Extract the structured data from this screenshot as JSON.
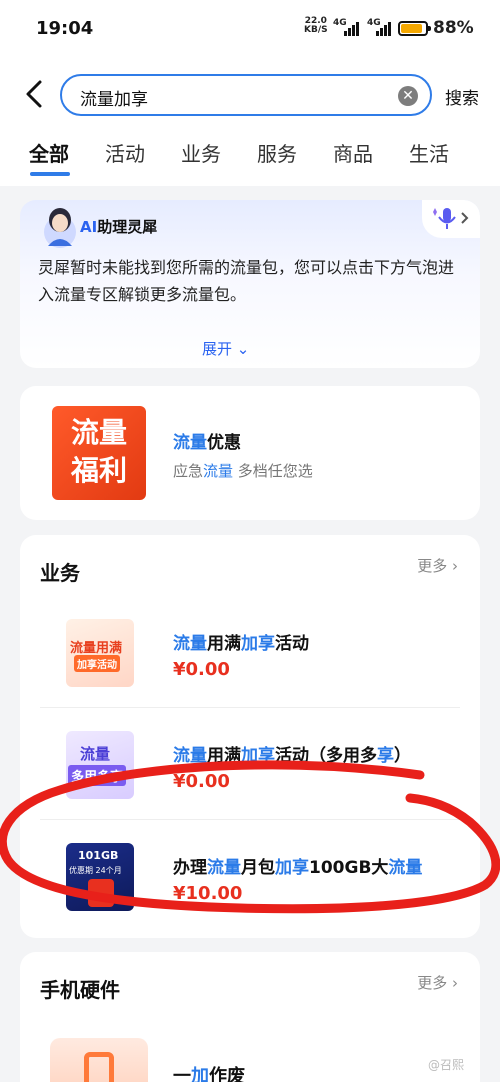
{
  "status": {
    "time": "19:04",
    "speed_value": "22.0",
    "speed_unit": "KB/S",
    "sim1": "4G",
    "sim2": "4G",
    "battery": "88%",
    "battery_level": 0.88
  },
  "search": {
    "query": "流量加享",
    "search_label": "搜索"
  },
  "tabs": [
    "全部",
    "活动",
    "业务",
    "服务",
    "商品",
    "生活"
  ],
  "assistant": {
    "badge": "AI",
    "name": "助理灵犀",
    "message": "灵犀暂时未能找到您所需的流量包，您可以点击下方气泡进入流量专区解锁更多流量包。",
    "expand": "展开"
  },
  "promo": {
    "image_text_1": "流量",
    "image_text_2": "福利",
    "title_hl": "流量",
    "title_rest": "优惠",
    "sub_1": "应急",
    "sub_hl": "流量",
    "sub_2": " 多档任您选"
  },
  "business": {
    "title": "业务",
    "more": "更多",
    "items": [
      {
        "t1": "流量",
        "t2": "用满",
        "t3": "加享",
        "t4": "活动",
        "t5": "",
        "t6": "",
        "price": "¥0.00",
        "thumb_line1": "流量用满",
        "thumb_line2": "加享活动",
        "thumb_tag": ""
      },
      {
        "t1": "流量",
        "t2": "用满",
        "t3": "加享",
        "t4": "活动（多用多",
        "t5": "享",
        "t6": "）",
        "price": "¥0.00",
        "thumb_line1": "流量",
        "thumb_line2": "多用多享",
        "thumb_tag": ""
      },
      {
        "t1": "办理",
        "t2": "流量",
        "t3": "月包",
        "t4": "加享",
        "t5": "100GB大",
        "t6": "流量",
        "price": "¥10.00",
        "thumb_line1": "101GB",
        "thumb_line2": "优惠期 24个月",
        "thumb_tag": ""
      }
    ]
  },
  "hardware": {
    "title": "手机硬件",
    "more": "更多",
    "item_title_1": "一",
    "item_title_hl": "加",
    "item_title_2": "作废"
  },
  "watermark": "@召熙",
  "colors": {
    "accent": "#2f7ce8",
    "highlight": "#2b7be8",
    "price": "#e8301f",
    "annotation": "#e8201a"
  }
}
